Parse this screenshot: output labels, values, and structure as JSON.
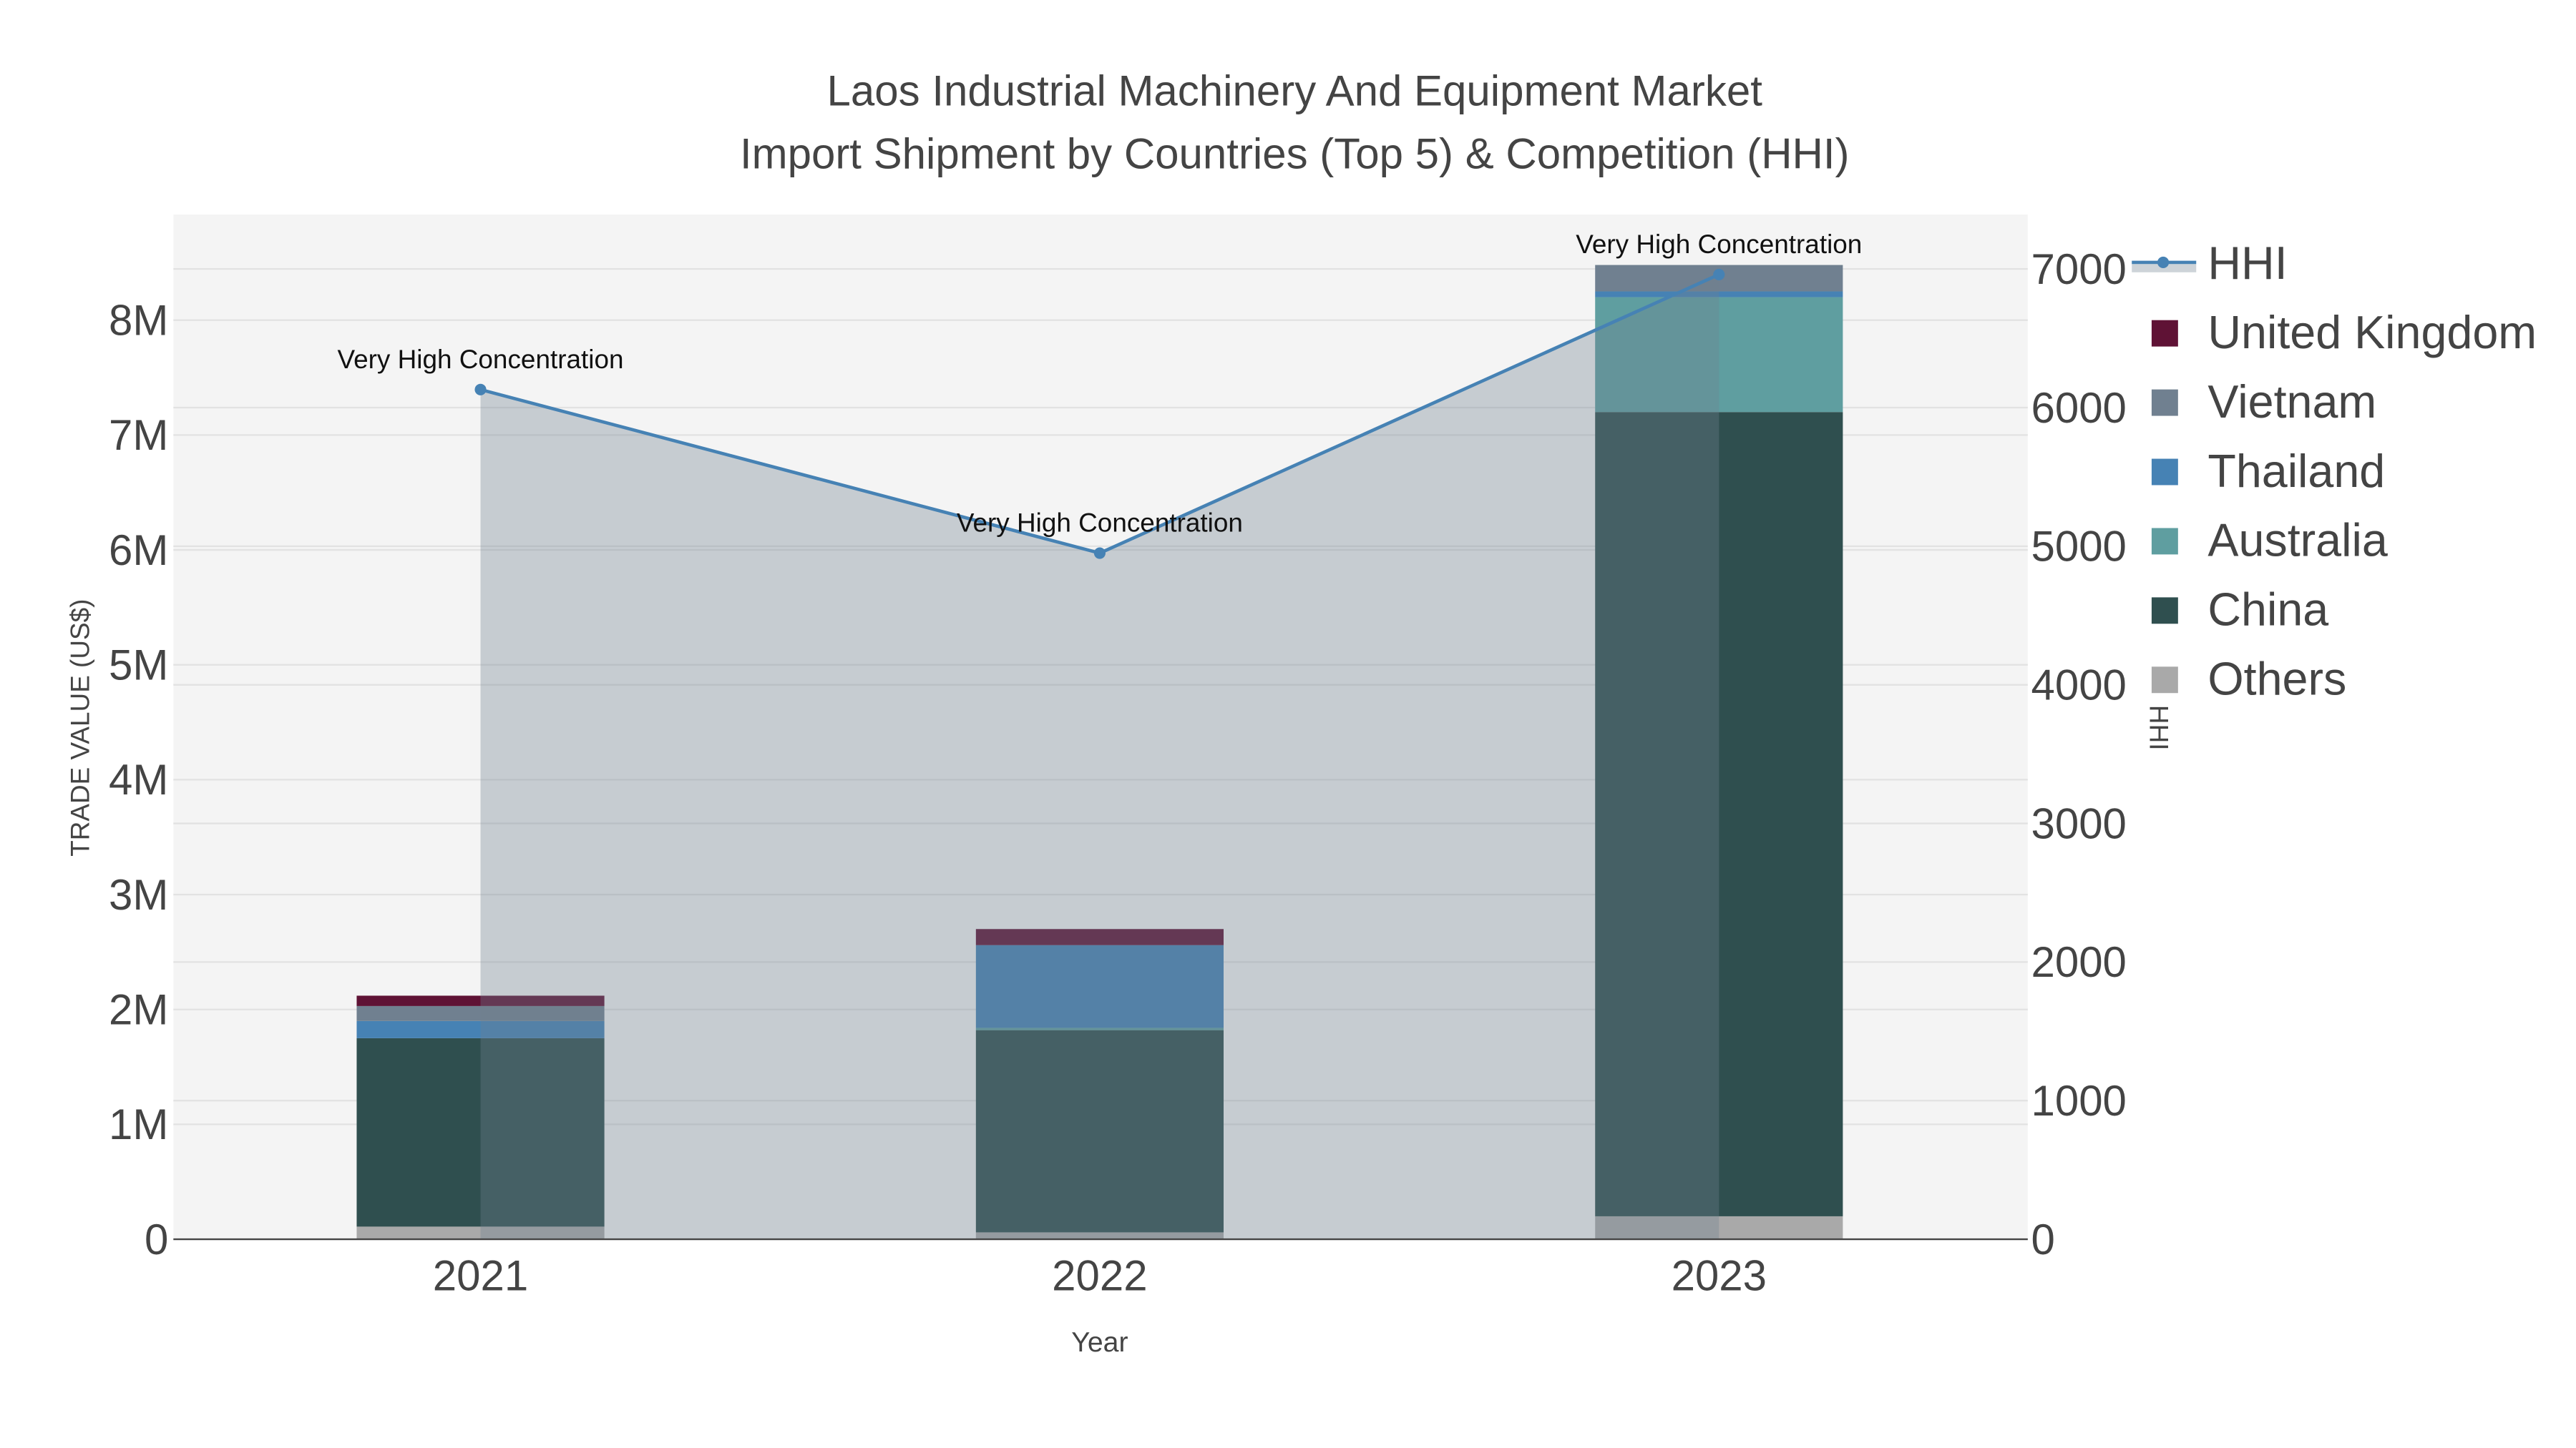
{
  "chart_data": {
    "type": "bar",
    "title": "Laos Industrial Machinery And Equipment Market",
    "subtitle": "Import Shipment by Countries (Top 5) & Competition (HHI)",
    "xlabel": "Year",
    "ylabel": "TRADE VALUE (US$)",
    "y2label": "HHI",
    "categories": [
      "2021",
      "2022",
      "2023"
    ],
    "ylim": [
      0,
      8900000
    ],
    "y2lim": [
      0,
      7400
    ],
    "yticks": [
      0,
      1000000,
      2000000,
      3000000,
      4000000,
      5000000,
      6000000,
      7000000,
      8000000
    ],
    "ytick_labels": [
      "0",
      "1M",
      "2M",
      "3M",
      "4M",
      "5M",
      "6M",
      "7M",
      "8M"
    ],
    "y2ticks": [
      0,
      1000,
      2000,
      3000,
      4000,
      5000,
      6000,
      7000
    ],
    "y2tick_labels": [
      "0",
      "1000",
      "2000",
      "3000",
      "4000",
      "5000",
      "6000",
      "7000"
    ],
    "stacked": true,
    "series": [
      {
        "name": "Others",
        "color": "#a9a9a9",
        "values": [
          110000,
          60000,
          200000
        ]
      },
      {
        "name": "China",
        "color": "#2f4f4f",
        "values": [
          1640000,
          1760000,
          7000000
        ]
      },
      {
        "name": "Australia",
        "color": "#5f9ea0",
        "values": [
          0,
          20000,
          1000000
        ]
      },
      {
        "name": "Thailand",
        "color": "#4682b4",
        "values": [
          150000,
          720000,
          50000
        ]
      },
      {
        "name": "Vietnam",
        "color": "#708090",
        "values": [
          130000,
          0,
          230000
        ]
      },
      {
        "name": "United Kingdom",
        "color": "#5f1235",
        "values": [
          90000,
          140000,
          0
        ]
      }
    ],
    "hhi": {
      "name": "HHI",
      "color": "#4682b4",
      "values": [
        6130,
        4950,
        6960
      ],
      "annotations": [
        "Very High Concentration",
        "Very High Concentration",
        "Very High Concentration"
      ]
    },
    "legend": [
      "HHI",
      "United Kingdom",
      "Vietnam",
      "Thailand",
      "Australia",
      "China",
      "Others"
    ],
    "legend_position": "right",
    "grid": true
  }
}
